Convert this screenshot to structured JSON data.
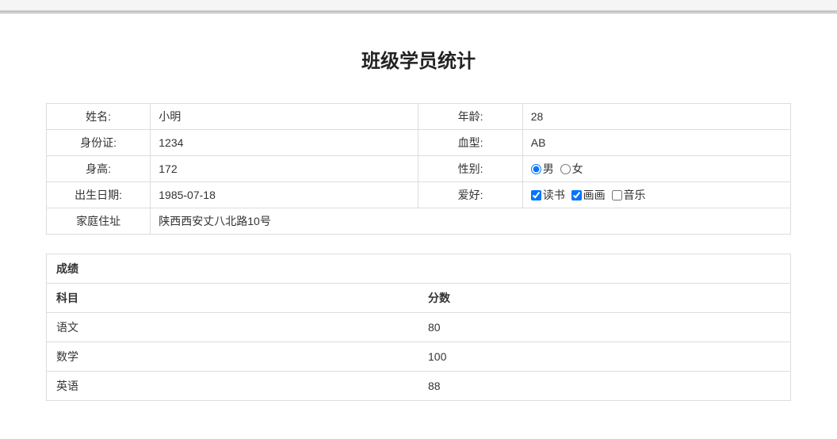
{
  "title": "班级学员统计",
  "info": {
    "name_label": "姓名:",
    "name_value": "小明",
    "age_label": "年龄:",
    "age_value": "28",
    "id_label": "身份证:",
    "id_value": "1234",
    "blood_label": "血型:",
    "blood_value": "AB",
    "height_label": "身高:",
    "height_value": "172",
    "gender_label": "性别:",
    "gender_options": [
      {
        "label": "男",
        "checked": true
      },
      {
        "label": "女",
        "checked": false
      }
    ],
    "birth_label": "出生日期:",
    "birth_value": "1985-07-18",
    "hobby_label": "爱好:",
    "hobby_options": [
      {
        "label": "读书",
        "checked": true
      },
      {
        "label": "画画",
        "checked": true
      },
      {
        "label": "音乐",
        "checked": false
      }
    ],
    "address_label": "家庭住址",
    "address_value": "陕西西安丈八北路10号"
  },
  "scores": {
    "panel_title": "成绩",
    "col_subject": "科目",
    "col_score": "分数",
    "rows": [
      {
        "subject": "语文",
        "score": "80"
      },
      {
        "subject": "数学",
        "score": "100"
      },
      {
        "subject": "英语",
        "score": "88"
      }
    ]
  }
}
